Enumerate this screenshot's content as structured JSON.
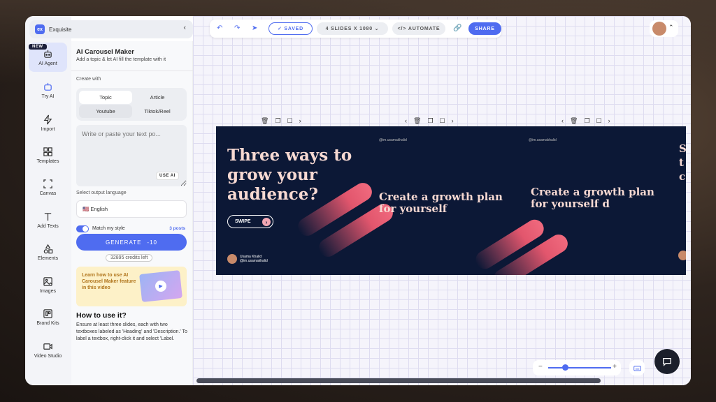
{
  "app": {
    "name": "Exquisite",
    "logo_text": "ex"
  },
  "rail": {
    "new_badge": "NEW",
    "items": [
      {
        "label": "AI Agent"
      },
      {
        "label": "Try AI"
      },
      {
        "label": "Import"
      },
      {
        "label": "Templates"
      },
      {
        "label": "Canvas"
      },
      {
        "label": "Add Texts"
      },
      {
        "label": "Elements"
      },
      {
        "label": "Images"
      },
      {
        "label": "Brand Kits"
      },
      {
        "label": "Video Studio"
      }
    ]
  },
  "panel": {
    "title": "AI Carousel Maker",
    "subtitle": "Add a topic & let AI fill the template with it",
    "create_with_label": "Create with",
    "options": [
      "Topic",
      "Article",
      "Youtube",
      "Tiktok/Reel"
    ],
    "textarea_placeholder": "Write or paste your text po...",
    "use_ai": "USE AI",
    "language_label": "Select output language",
    "language_value": "🇺🇸 English",
    "match_style": "Match my style",
    "posts": "3 posts",
    "generate": "GENERATE",
    "generate_cost": "-10",
    "credits": "32895 credits left",
    "promo_text": "Learn how to use AI Carousel Maker feature in this video",
    "howto_title": "How to use it?",
    "howto_desc": "Ensure at least three slides, each with two textboxes labeled as 'Heading' and 'Description.' To label a textbox, right-click it and select 'Label."
  },
  "toolbar": {
    "saved": "SAVED",
    "slides": "4 SLIDES X 1080",
    "automate": "AUTOMATE",
    "share": "SHARE"
  },
  "slides": {
    "heading1": "Three ways to grow your audience?",
    "swipe": "SWIPE",
    "handle": "@im.usamakhalid",
    "heading2": "Create a growth plan for yourself",
    "heading3": "Create a growth plan for yourself d",
    "heading4_partial": "S t c",
    "author_name": "Usama Khalid",
    "author_handle": "@im.usamakhalid"
  },
  "colors": {
    "accent": "#4f6cf0",
    "slide_bg": "#0c1836",
    "slide_text": "#f7d9d2",
    "pill": "#e2566d"
  }
}
